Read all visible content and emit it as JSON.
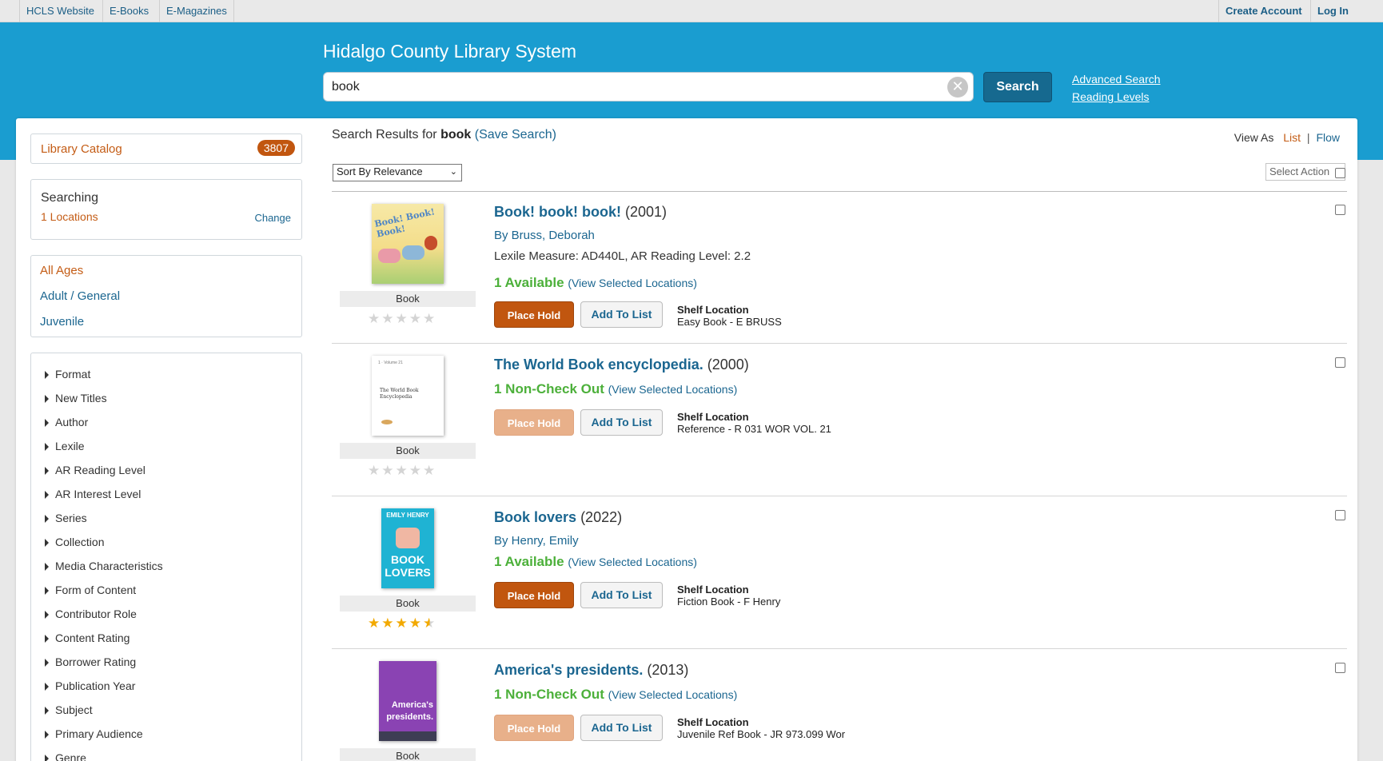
{
  "topbar": {
    "links": [
      "HCLS Website",
      "E-Books",
      "E-Magazines"
    ],
    "create_account": "Create Account",
    "log_in": "Log In"
  },
  "header": {
    "title": "Hidalgo County Library System",
    "search_value": "book",
    "search_button": "Search",
    "advanced_search": "Advanced Search",
    "reading_levels": "Reading Levels"
  },
  "sidebar": {
    "catalog_label": "Library Catalog",
    "catalog_count": "3807",
    "searching_label": "Searching",
    "locations": "1 Locations",
    "change": "Change",
    "ages": [
      "All Ages",
      "Adult / General",
      "Juvenile"
    ],
    "facets": [
      "Format",
      "New Titles",
      "Author",
      "Lexile",
      "AR Reading Level",
      "AR Interest Level",
      "Series",
      "Collection",
      "Media Characteristics",
      "Form of Content",
      "Contributor Role",
      "Content Rating",
      "Borrower Rating",
      "Publication Year",
      "Subject",
      "Primary Audience",
      "Genre"
    ]
  },
  "results": {
    "prefix": "Search Results for ",
    "query": "book",
    "save_search": "(Save Search)",
    "view_as": "View As",
    "view_list": "List",
    "view_flow": "Flow",
    "sort": "Sort By Relevance",
    "select_action": "Select Action",
    "items": [
      {
        "title": "Book! book! book!",
        "year": "(2001)",
        "author": "By Bruss, Deborah",
        "lexile": "Lexile Measure: AD440L, AR Reading Level: 2.2",
        "availability": "1 Available",
        "view_locations": "(View Selected Locations)",
        "hold": "Place Hold",
        "add_list": "Add To List",
        "shelf_label": "Shelf Location",
        "shelf": "Easy Book - E BRUSS",
        "format": "Book",
        "rating": 0,
        "cover_text": "Book! Book! Book!"
      },
      {
        "title": "The World Book encyclopedia.",
        "year": "(2000)",
        "availability": "1 Non-Check Out",
        "view_locations": "(View Selected Locations)",
        "hold": "Place Hold",
        "add_list": "Add To List",
        "shelf_label": "Shelf Location",
        "shelf": "Reference - R 031 WOR VOL. 21",
        "format": "Book",
        "rating": 0,
        "cover_text": "The World Book Encyclopedia"
      },
      {
        "title": "Book lovers",
        "year": "(2022)",
        "author": "By Henry, Emily",
        "availability": "1 Available",
        "view_locations": "(View Selected Locations)",
        "hold": "Place Hold",
        "add_list": "Add To List",
        "shelf_label": "Shelf Location",
        "shelf": "Fiction Book - F Henry",
        "format": "Book",
        "rating": 4.5,
        "cover_author": "EMILY HENRY",
        "cover_text": "BOOK LOVERS"
      },
      {
        "title": "America's presidents.",
        "year": "(2013)",
        "availability": "1 Non-Check Out",
        "view_locations": "(View Selected Locations)",
        "hold": "Place Hold",
        "add_list": "Add To List",
        "shelf_label": "Shelf Location",
        "shelf": "Juvenile Ref Book - JR 973.099 Wor",
        "format": "Book",
        "cover_text": "America's presidents."
      }
    ]
  }
}
